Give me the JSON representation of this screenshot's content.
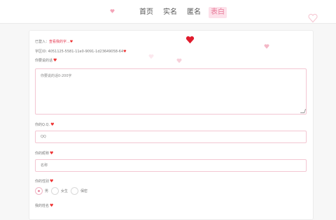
{
  "nav": {
    "items": [
      {
        "label": "首页",
        "active": false
      },
      {
        "label": "实名",
        "active": false
      },
      {
        "label": "匿名",
        "active": false
      },
      {
        "label": "表白",
        "active": true
      }
    ]
  },
  "form": {
    "login_prefix": "已登入：",
    "login_link": "查看我的字...",
    "uid_text": "字区ID: 4051125-5581-11e0-9091-1d23649058-64",
    "want_label": "你要说的话",
    "want_placeholder": "你要说的话0-200字",
    "qq_label": "你的Q.Q.",
    "qq_placeholder": "QQ",
    "name_label": "你的昵称",
    "name_placeholder": "名称",
    "gender_label": "你的性别",
    "gender_options": [
      {
        "label": "男",
        "checked": true
      },
      {
        "label": "女生",
        "checked": false
      },
      {
        "label": "保密",
        "checked": false
      }
    ],
    "bottom_label": "我的姓名"
  },
  "colors": {
    "accent": "#e77a98",
    "heart_red": "#e01c2d",
    "heart_pink": "#f4b8c7"
  }
}
